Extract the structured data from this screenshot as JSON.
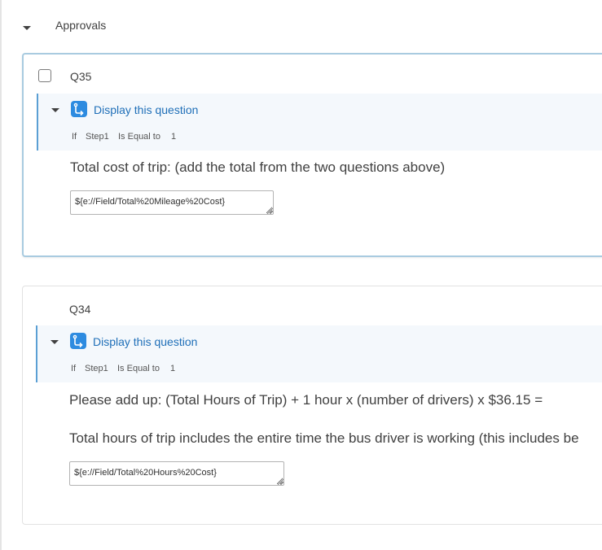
{
  "block": {
    "title": "Approvals"
  },
  "questions": [
    {
      "id": "Q35",
      "display_logic": {
        "label": "Display this question",
        "if": "If",
        "field": "Step1",
        "operator": "Is Equal to",
        "value": "1"
      },
      "text": "Total cost of trip: (add the total from the two questions above)",
      "answer_value": "${e://Field/Total%20Mileage%20Cost}"
    },
    {
      "id": "Q34",
      "display_logic": {
        "label": "Display this question",
        "if": "If",
        "field": "Step1",
        "operator": "Is Equal to",
        "value": "1"
      },
      "text_line1": "Please add up: (Total Hours of Trip) + 1 hour x (number of drivers) x $36.15 =",
      "text_line2": "Total hours of trip includes the entire time the bus driver is working (this includes be",
      "answer_value": "${e://Field/Total%20Hours%20Cost}"
    }
  ],
  "icons": {
    "block_toggle": "caret-down-icon",
    "logic": "display-logic-icon"
  },
  "colors": {
    "accent": "#2d8be0",
    "logic_link": "#1f6fb8",
    "selected_border": "#a9cbe0",
    "logic_bg": "#f4f8fc"
  }
}
